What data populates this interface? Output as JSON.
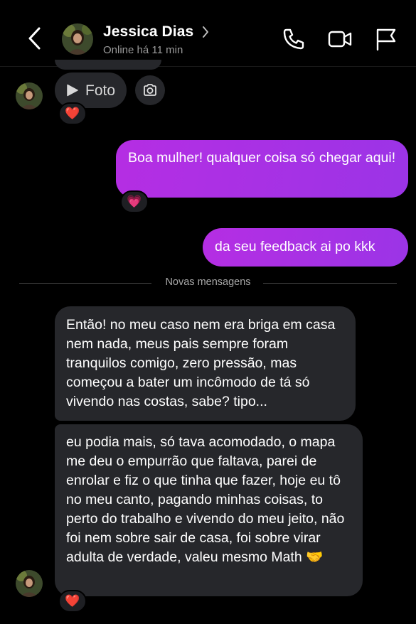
{
  "header": {
    "name": "Jessica Dias",
    "status": "Online há 11 min"
  },
  "attachment": {
    "label": "Foto"
  },
  "messages": {
    "out1": "Boa mulher! qualquer coisa só chegar aqui!",
    "out2": "da seu feedback ai po kkk",
    "in1": "Então! no meu caso nem era briga em casa nem nada, meus pais sempre foram tranquilos comigo, zero pressão, mas começou a bater um incômodo de tá só vivendo nas costas, sabe? tipo...",
    "in2": "eu podia mais, só tava acomodado, o mapa me deu o empurrão que faltava, parei de enrolar e fiz o que tinha que fazer, hoje eu tô no meu canto, pagando minhas coisas, to perto do trabalho e vivendo do meu jeito, não foi nem sobre sair de casa, foi sobre virar adulta de verdade, valeu mesmo Math 🤝"
  },
  "divider": {
    "label": "Novas mensagens"
  },
  "reactions": {
    "foto": "❤️",
    "out1": "💗",
    "in2": "❤️"
  },
  "colors": {
    "background": "#000000",
    "incoming_bubble": "#26272b",
    "outgoing_bubble": "#a030e0"
  }
}
